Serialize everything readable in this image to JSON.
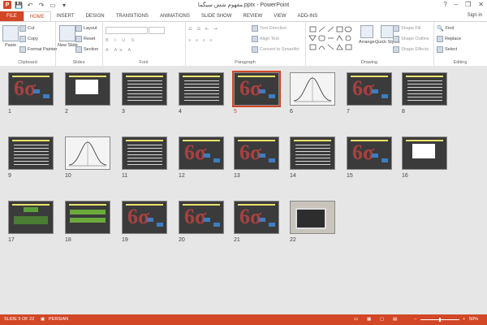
{
  "window": {
    "title": "مفهوم شش سیگما.pptx - PowerPoint",
    "help": "?",
    "minimize": "–",
    "restore": "❐",
    "close": "✕"
  },
  "qat": {
    "app_icon": "P",
    "save": "💾",
    "undo": "↶",
    "redo": "↷",
    "present": "▭",
    "customize": "▾"
  },
  "tabs": [
    "FILE",
    "HOME",
    "INSERT",
    "DESIGN",
    "TRANSITIONS",
    "ANIMATIONS",
    "SLIDE SHOW",
    "REVIEW",
    "VIEW",
    "ADD-INS"
  ],
  "active_tab": "HOME",
  "sign_in": "Sign in",
  "ribbon": {
    "clipboard": {
      "label": "Clipboard",
      "paste": "Paste",
      "cut": "Cut",
      "copy": "Copy",
      "format_painter": "Format Painter"
    },
    "slides": {
      "label": "Slides",
      "new_slide": "New Slide",
      "layout": "Layout",
      "reset": "Reset",
      "section": "Section"
    },
    "font": {
      "label": "Font"
    },
    "paragraph": {
      "label": "Paragraph",
      "text_direction": "Text Direction",
      "align_text": "Align Text",
      "convert_smartart": "Convert to SmartArt"
    },
    "drawing": {
      "label": "Drawing",
      "arrange": "Arrange",
      "quick_styles": "Quick Styles",
      "shape_fill": "Shape Fill",
      "shape_outline": "Shape Outline",
      "shape_effects": "Shape Effects"
    },
    "editing": {
      "label": "Editing",
      "find": "Find",
      "replace": "Replace",
      "select": "Select"
    }
  },
  "slides": [
    {
      "n": "1",
      "kind": "dark-six"
    },
    {
      "n": "2",
      "kind": "chart"
    },
    {
      "n": "3",
      "kind": "text"
    },
    {
      "n": "4",
      "kind": "text"
    },
    {
      "n": "5",
      "kind": "dark-six",
      "selected": true
    },
    {
      "n": "6",
      "kind": "white-curve"
    },
    {
      "n": "7",
      "kind": "dark-six"
    },
    {
      "n": "8",
      "kind": "text"
    },
    {
      "n": "9",
      "kind": "text"
    },
    {
      "n": "10",
      "kind": "white-curve"
    },
    {
      "n": "11",
      "kind": "text"
    },
    {
      "n": "12",
      "kind": "dark-six"
    },
    {
      "n": "13",
      "kind": "dark-six"
    },
    {
      "n": "14",
      "kind": "text"
    },
    {
      "n": "15",
      "kind": "dark-six"
    },
    {
      "n": "16",
      "kind": "chart2"
    },
    {
      "n": "17",
      "kind": "diagram"
    },
    {
      "n": "18",
      "kind": "green"
    },
    {
      "n": "19",
      "kind": "dark-six"
    },
    {
      "n": "20",
      "kind": "dark-six"
    },
    {
      "n": "21",
      "kind": "dark-six"
    },
    {
      "n": "22",
      "kind": "photo"
    }
  ],
  "status": {
    "slide": "SLIDE 5 OF 22",
    "language": "PERSIAN",
    "zoom": "50%",
    "zoom_level": 0.5
  },
  "colors": {
    "accent": "#d24726",
    "sorter_bg": "#e6e6e6"
  }
}
